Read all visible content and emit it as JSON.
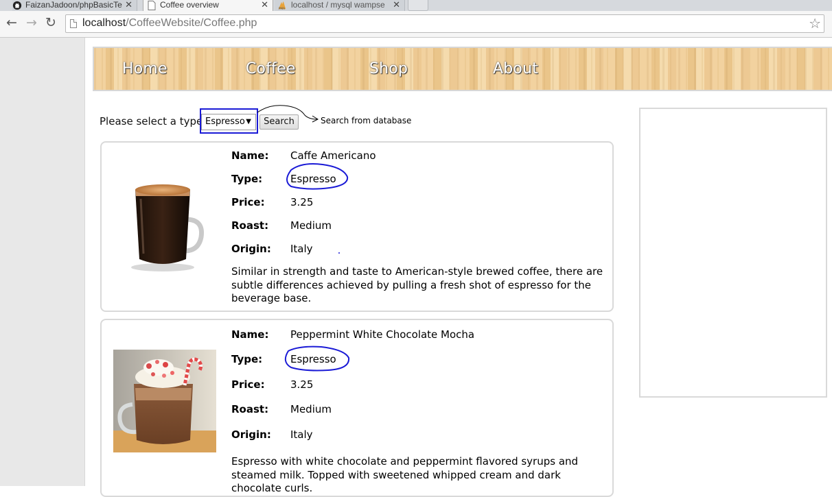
{
  "browser": {
    "tabs": [
      {
        "title": "FaizanJadoon/phpBasicTe",
        "icon": "github-icon",
        "active": false
      },
      {
        "title": "Coffee overview",
        "icon": "page-icon",
        "active": true
      },
      {
        "title": "localhost / mysql wampse",
        "icon": "phpmyadmin-icon",
        "active": false
      }
    ],
    "url_host": "localhost",
    "url_path": "/CoffeeWebsite/Coffee.php"
  },
  "nav": {
    "items": [
      "Home",
      "Coffee",
      "Shop",
      "About"
    ]
  },
  "filter": {
    "label": "Please select a type:",
    "selected": "Espresso",
    "button": "Search",
    "annotation": "Search from database"
  },
  "field_labels": {
    "name": "Name:",
    "type": "Type:",
    "price": "Price:",
    "roast": "Roast:",
    "origin": "Origin:"
  },
  "products": [
    {
      "name": "Caffe Americano",
      "type": "Espresso",
      "price": "3.25",
      "roast": "Medium",
      "origin": "Italy",
      "description": "Similar in strength and taste to American-style brewed coffee, there are subtle differences achieved by pulling a fresh shot of espresso for the beverage base."
    },
    {
      "name": "Peppermint White Chocolate Mocha",
      "type": "Espresso",
      "price": "3.25",
      "roast": "Medium",
      "origin": "Italy",
      "description": "Espresso with white chocolate and peppermint flavored syrups and steamed milk. Topped with sweetened whipped cream and dark chocolate curls."
    }
  ],
  "colors": {
    "annotation_ink": "#1a1ad6",
    "nav_wood": "#efcc95"
  }
}
